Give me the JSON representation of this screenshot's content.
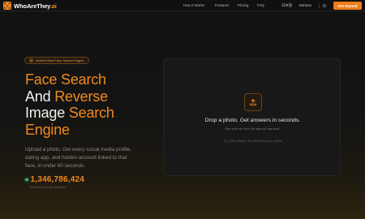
{
  "nav": {
    "brand_main": "WhoAreThey",
    "brand_suffix": ".ai",
    "links": [
      "How It Works",
      "Features",
      "Pricing",
      "FAQ"
    ],
    "languages": [
      "日本語",
      "Bahasa"
    ],
    "cta_label": "Get Started"
  },
  "hero": {
    "badge": "World's Best Face Search Engine",
    "headline": {
      "part1": "Face Search",
      "part2": "And",
      "part3": "Reverse",
      "part4": "Image",
      "part5": "Search",
      "part6": "Engine"
    },
    "subtitle": "Upload a photo. Get every social media profile, dating app, and hidden account linked to that face, in under 60 seconds.",
    "counter_value": "1,346,786,424",
    "counter_caption": "faces ready to be searched"
  },
  "dropzone": {
    "title": "Drop a photo. Get answers in seconds.",
    "subtitle": "See who we find. No sign-up required.",
    "privacy": "100% private. We don't store your photos"
  },
  "colors": {
    "accent": "#f08a1e",
    "background": "#121212",
    "live_dot": "#36b96b"
  }
}
